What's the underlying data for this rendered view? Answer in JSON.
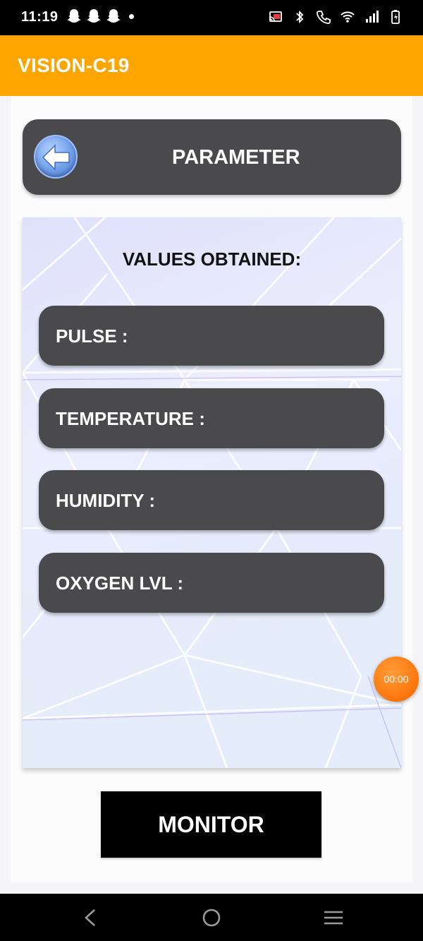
{
  "status_bar": {
    "time": "11:19",
    "left_icons": [
      "snapchat-icon",
      "snapchat-icon",
      "snapchat-icon",
      "dot-icon"
    ],
    "right_icons": [
      "cast-icon",
      "bluetooth-icon",
      "call-icon",
      "wifi-icon",
      "signal-icon",
      "battery-icon"
    ]
  },
  "app_bar": {
    "title": "VISION-C19",
    "color": "#ffa500"
  },
  "parameter_card": {
    "title": "PARAMETER",
    "back_icon": "back-arrow-icon"
  },
  "values_panel": {
    "title": "VALUES OBTAINED:",
    "rows": [
      {
        "label": "PULSE :",
        "value": ""
      },
      {
        "label": "TEMPERATURE :",
        "value": ""
      },
      {
        "label": "HUMIDITY :",
        "value": ""
      },
      {
        "label": "OXYGEN LVL :",
        "value": ""
      }
    ]
  },
  "timer": {
    "text": "00:00"
  },
  "monitor_button": {
    "label": "MONITOR"
  },
  "nav_bar": {
    "icons": [
      "back-icon",
      "home-icon",
      "recents-icon"
    ]
  }
}
